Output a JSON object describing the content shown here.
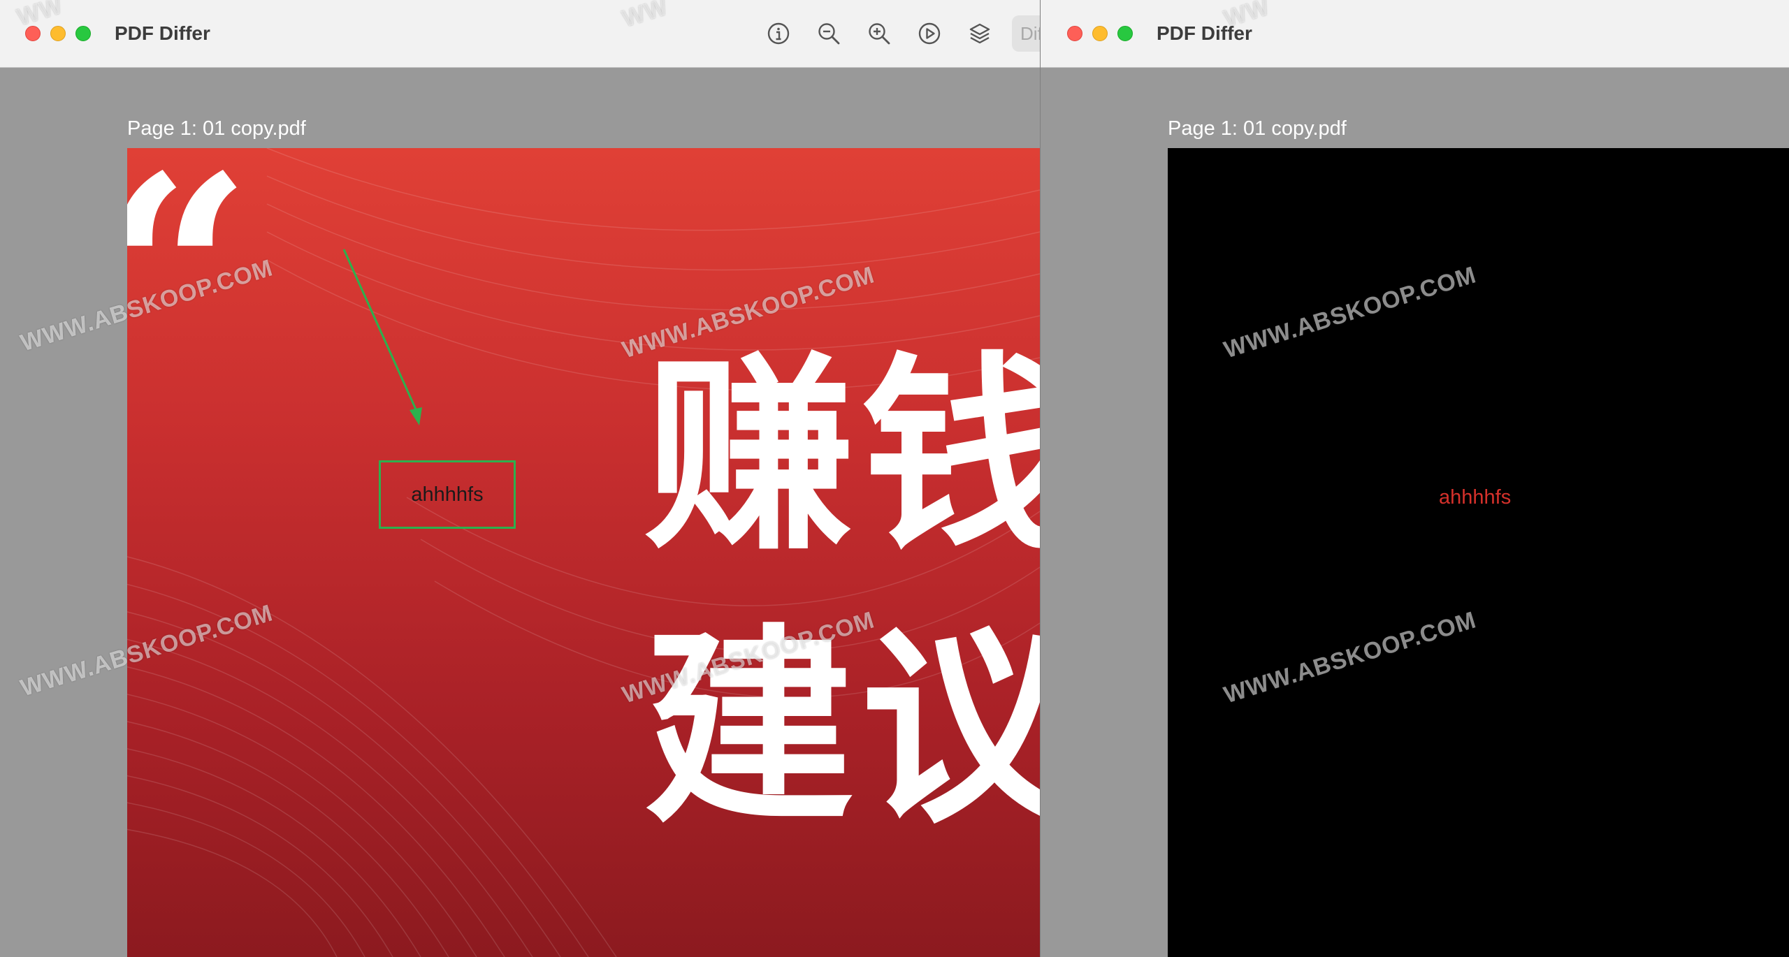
{
  "app": {
    "title": "PDF Differ"
  },
  "toolbar": {
    "icons": [
      "info-icon",
      "zoom-out-icon",
      "zoom-in-icon",
      "play-icon",
      "layers-icon"
    ],
    "search_stub": "Dif"
  },
  "left_window": {
    "page_label": "Page 1: 01 copy.pdf",
    "quote_mark": "“",
    "chars_line1": "赚钱",
    "chars_line2": "建议",
    "annotation_text": "ahhhhfs"
  },
  "right_window": {
    "page_label": "Page 1: 01 copy.pdf",
    "diff_text": "ahhhhfs"
  },
  "watermark": {
    "text": "WWW.ABSKOOP.COM",
    "partial": "WW"
  },
  "colors": {
    "page_red": "#c92f2f",
    "annotation_green": "#2db04e",
    "diff_text_red": "#d5312b",
    "window_gray": "#999999"
  }
}
